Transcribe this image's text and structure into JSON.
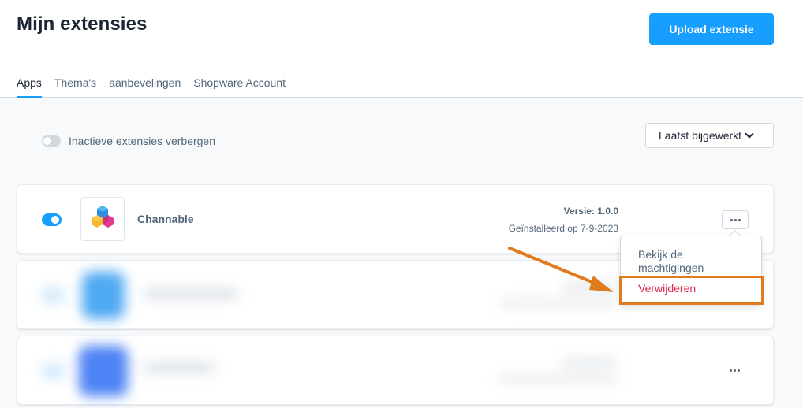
{
  "header": {
    "title": "Mijn extensies",
    "upload_button": "Upload extensie",
    "tabs": [
      {
        "label": "Apps",
        "active": true
      },
      {
        "label": "Thema's",
        "active": false
      },
      {
        "label": "aanbevelingen",
        "active": false
      },
      {
        "label": "Shopware Account",
        "active": false
      }
    ]
  },
  "filter": {
    "hide_inactive_label": "Inactieve extensies verbergen",
    "hide_inactive_on": false,
    "sort_label": "Laatst bijgewerkt"
  },
  "extensions": [
    {
      "name": "Channable",
      "active": true,
      "version": "Versie: 1.0.0",
      "installed": "Geïnstalleerd op 7-9-2023"
    }
  ],
  "context_menu": {
    "items": [
      {
        "label": "Bekijk de machtigingen"
      },
      {
        "label": "Verwijderen"
      }
    ]
  },
  "colors": {
    "primary": "#189eff",
    "danger": "#de294c",
    "annotation": "#e07c20"
  },
  "icons": {
    "more": "more-horizontal-icon",
    "chevron": "chevron-down-icon",
    "logo": "channable-logo-icon"
  }
}
